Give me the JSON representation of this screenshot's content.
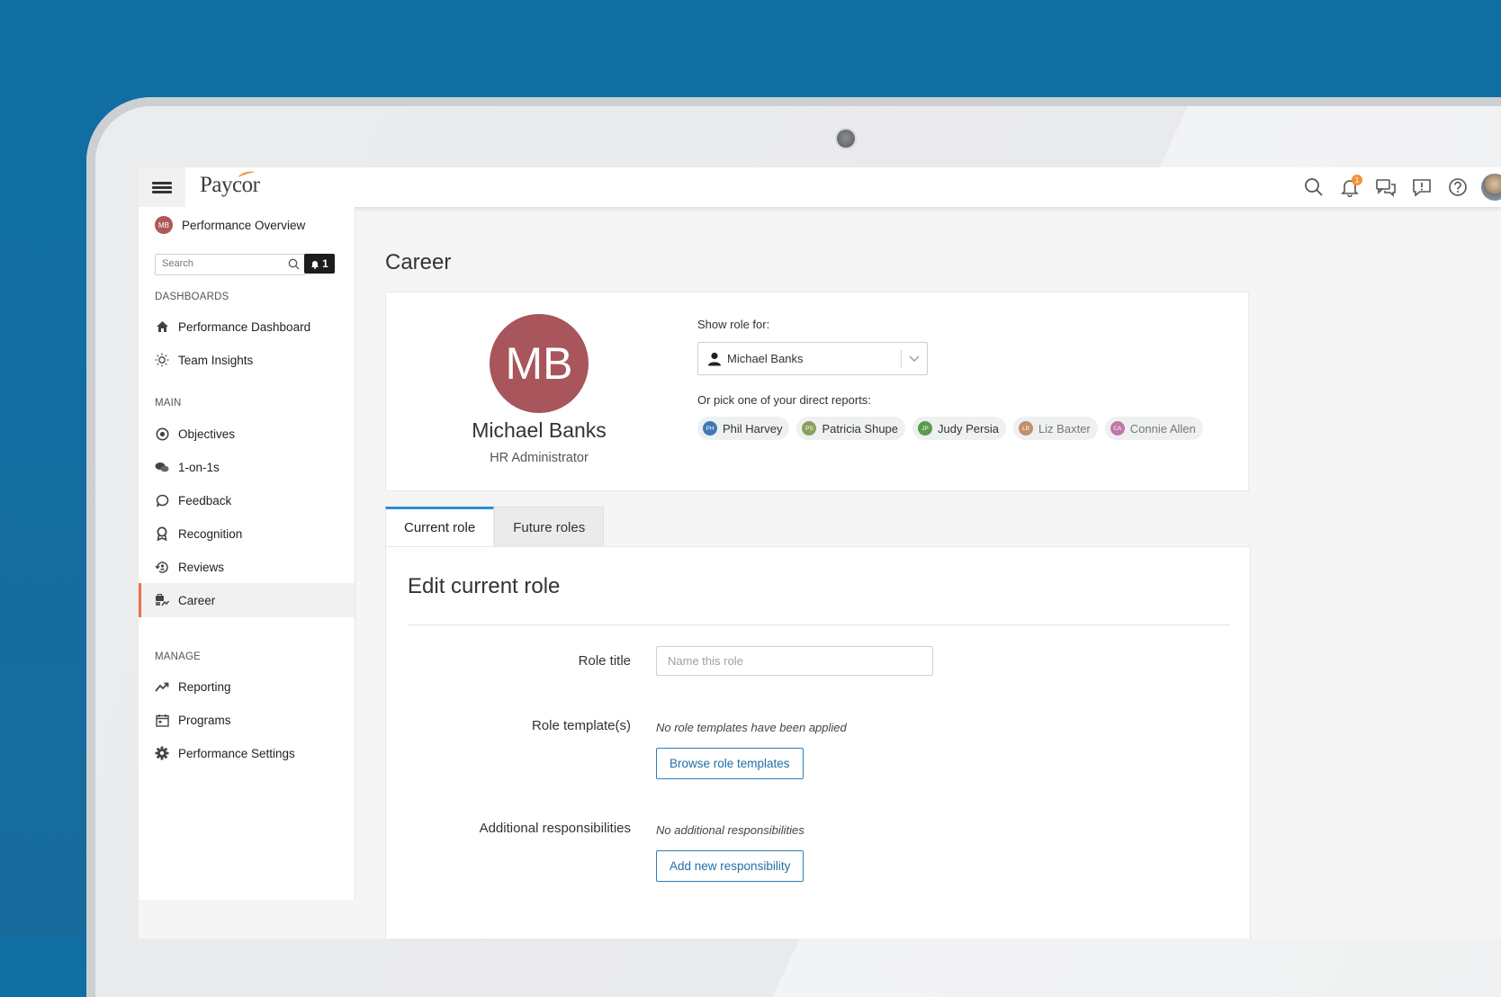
{
  "app": {
    "logo_text": "Paycor"
  },
  "topbar": {
    "icons": [
      "search-icon",
      "bell-icon",
      "chat-icon",
      "feedback-icon",
      "help-icon"
    ],
    "notification_count": "1"
  },
  "sidebar": {
    "overview": {
      "avatar_initials": "MB",
      "label": "Performance Overview"
    },
    "search_placeholder": "Search",
    "alert_count": "1",
    "sections": {
      "dashboards": "DASHBOARDS",
      "main": "MAIN",
      "manage": "MANAGE"
    },
    "items": [
      {
        "label": "Performance Dashboard",
        "icon": "home-icon"
      },
      {
        "label": "Team Insights",
        "icon": "lightbulb-icon"
      },
      {
        "label": "Objectives",
        "icon": "target-icon"
      },
      {
        "label": "1-on-1s",
        "icon": "conversation-icon"
      },
      {
        "label": "Feedback",
        "icon": "feedback-bubble-icon"
      },
      {
        "label": "Recognition",
        "icon": "ribbon-icon"
      },
      {
        "label": "Reviews",
        "icon": "review-icon"
      },
      {
        "label": "Career",
        "icon": "career-icon"
      },
      {
        "label": "Reporting",
        "icon": "trend-icon"
      },
      {
        "label": "Programs",
        "icon": "calendar-icon"
      },
      {
        "label": "Performance Settings",
        "icon": "gear-icon"
      }
    ],
    "active_item": "Career"
  },
  "main": {
    "page_title": "Career",
    "profile": {
      "initials": "MB",
      "name": "Michael Banks",
      "role": "HR Administrator",
      "show_role_label": "Show role for:",
      "selected_person": "Michael Banks",
      "pick_label": "Or pick one of your direct reports:",
      "direct_reports": [
        {
          "initials": "PH",
          "name": "Phil Harvey",
          "color": "#3f78b5",
          "text_color": "#333333"
        },
        {
          "initials": "PS",
          "name": "Patricia Shupe",
          "color": "#8aa05a",
          "text_color": "#333333"
        },
        {
          "initials": "JP",
          "name": "Judy Persia",
          "color": "#5a9a4a",
          "text_color": "#333333"
        },
        {
          "initials": "LB",
          "name": "Liz Baxter",
          "color": "#c0906a",
          "text_color": "#777777"
        },
        {
          "initials": "CA",
          "name": "Connie Allen",
          "color": "#c078a8",
          "text_color": "#777777"
        }
      ]
    },
    "tabs": [
      {
        "label": "Current role",
        "active": true
      },
      {
        "label": "Future roles",
        "active": false
      }
    ],
    "edit": {
      "title": "Edit current role",
      "role_title_label": "Role title",
      "role_title_placeholder": "Name this role",
      "templates_label": "Role template(s)",
      "templates_empty": "No role templates have been applied",
      "browse_button": "Browse role templates",
      "responsibilities_label": "Additional responsibilities",
      "responsibilities_empty": "No additional responsibilities",
      "add_button": "Add new responsibility"
    }
  },
  "colors": {
    "background_blue": "#0f6fa3",
    "accent_orange": "#e8734a",
    "accent_blue": "#2a8fd0",
    "avatar_red": "#a8555b"
  }
}
